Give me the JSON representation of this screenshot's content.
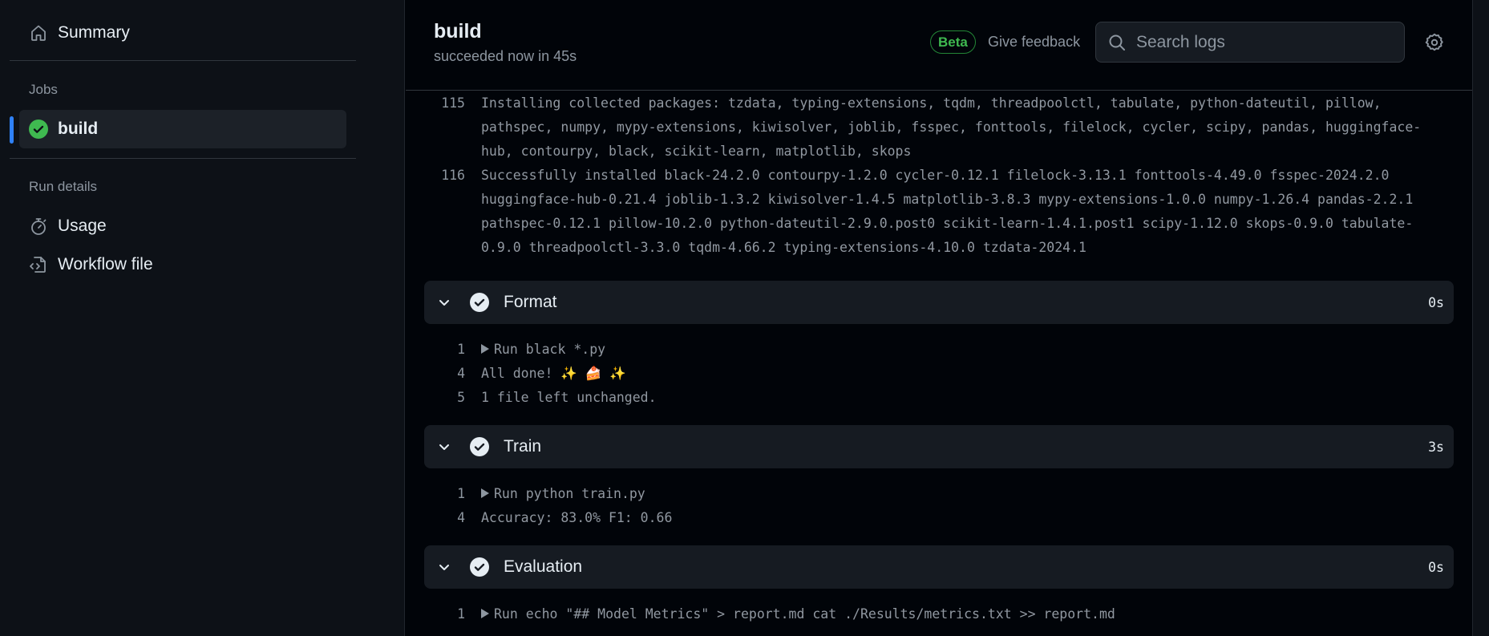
{
  "sidebar": {
    "summary_label": "Summary",
    "jobs_heading": "Jobs",
    "jobs": [
      {
        "label": "build",
        "status": "success",
        "active": true
      }
    ],
    "run_details_heading": "Run details",
    "run_details": [
      {
        "label": "Usage",
        "icon": "stopwatch-icon"
      },
      {
        "label": "Workflow file",
        "icon": "file-code-icon"
      }
    ]
  },
  "header": {
    "title": "build",
    "subtitle": "succeeded now in 45s",
    "beta_label": "Beta",
    "feedback_label": "Give feedback",
    "search_placeholder": "Search logs"
  },
  "colors": {
    "accent_blue": "#2f81f7",
    "success_green": "#3fb950",
    "beta_border": "#238636"
  },
  "log": {
    "pre_lines": [
      {
        "num": "115",
        "text": "Installing collected packages: tzdata, typing-extensions, tqdm, threadpoolctl, tabulate, python-dateutil, pillow, pathspec, numpy, mypy-extensions, kiwisolver, joblib, fsspec, fonttools, filelock, cycler, scipy, pandas, huggingface-hub, contourpy, black, scikit-learn, matplotlib, skops"
      },
      {
        "num": "116",
        "text": "Successfully installed black-24.2.0 contourpy-1.2.0 cycler-0.12.1 filelock-3.13.1 fonttools-4.49.0 fsspec-2024.2.0 huggingface-hub-0.21.4 joblib-1.3.2 kiwisolver-1.4.5 matplotlib-3.8.3 mypy-extensions-1.0.0 numpy-1.26.4 pandas-2.2.1 pathspec-0.12.1 pillow-10.2.0 python-dateutil-2.9.0.post0 scikit-learn-1.4.1.post1 scipy-1.12.0 skops-0.9.0 tabulate-0.9.0 threadpoolctl-3.3.0 tqdm-4.66.2 typing-extensions-4.10.0 tzdata-2024.1"
      }
    ],
    "steps": [
      {
        "name": "Format",
        "duration": "0s",
        "lines": [
          {
            "num": "1",
            "text": "Run black *.py",
            "collapsible": true
          },
          {
            "num": "4",
            "text": "All done! ✨ 🍰 ✨",
            "collapsible": false
          },
          {
            "num": "5",
            "text": "1 file left unchanged.",
            "collapsible": false
          }
        ]
      },
      {
        "name": "Train",
        "duration": "3s",
        "lines": [
          {
            "num": "1",
            "text": "Run python train.py",
            "collapsible": true
          },
          {
            "num": "4",
            "text": "Accuracy: 83.0% F1: 0.66",
            "collapsible": false
          }
        ]
      },
      {
        "name": "Evaluation",
        "duration": "0s",
        "lines": [
          {
            "num": "1",
            "text": "Run echo \"## Model Metrics\" > report.md cat ./Results/metrics.txt >> report.md",
            "collapsible": true
          }
        ]
      }
    ]
  }
}
